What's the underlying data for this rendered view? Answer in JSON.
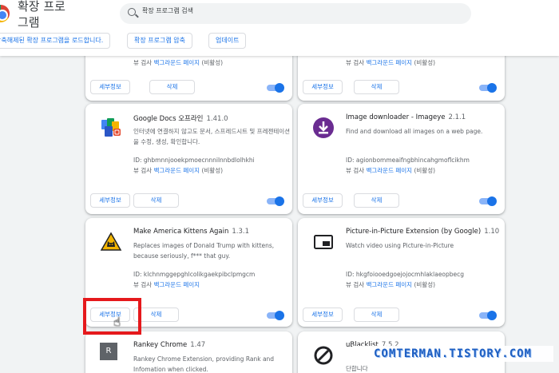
{
  "header": {
    "title": "확장 프로그램",
    "search_placeholder": "확장 프로그램 검색",
    "buttons": {
      "load_unpacked": "압축해제된 확장 프로그램을 로드합니다.",
      "pack": "확장 프로그램 압축",
      "update": "업데이트"
    }
  },
  "common": {
    "details_label": "세부정보",
    "remove_label": "삭제",
    "views_prefix": "뷰 검사",
    "views_link": "백그라운드 페이지",
    "views_inactive": "(비활성)"
  },
  "extensions": [
    {
      "name": "Google Docs 오프라인",
      "version": "1.41.0",
      "description": "인터넷에 연결하지 않고도 문서, 스프레드시트 및 프레젠테이션을 수정, 생성, 확인합니다.",
      "id": "ID: ghbmnnjooekpmoecnnnilnnbdlolhkhi",
      "enabled": true,
      "views_inactive": true
    },
    {
      "name": "Image downloader - Imageye",
      "version": "2.1.1",
      "description": "Find and download all images on a web page.",
      "id": "ID: agionbommeaifngbhincahgmoflcikhm",
      "enabled": true,
      "views_inactive": true
    },
    {
      "name": "Make America Kittens Again",
      "version": "1.3.1",
      "description": "Replaces images of Donald Trump with kittens, because seriously, f*** that guy.",
      "id": "ID: klchnmggepghlcolikgaekpibclpmgcm",
      "enabled": true,
      "views_inactive": false
    },
    {
      "name": "Picture-in-Picture Extension (by Google)",
      "version": "1.10",
      "description": "Watch video using Picture-in-Picture",
      "id": "ID: hkgfoiooedgoejojocmhlaklaeopbecg",
      "enabled": true,
      "views_inactive": true
    },
    {
      "name": "Rankey Chrome",
      "version": "1.47",
      "description": "Rankey Chrome Extension, providing Rank and Infomation when clicked."
    },
    {
      "name": "uBlacklist",
      "version": "7.5.2",
      "description": "단합니다"
    }
  ],
  "icons": {
    "rankey_letter": "R"
  },
  "watermark": "COMTERMAN.TISTORY.COM"
}
